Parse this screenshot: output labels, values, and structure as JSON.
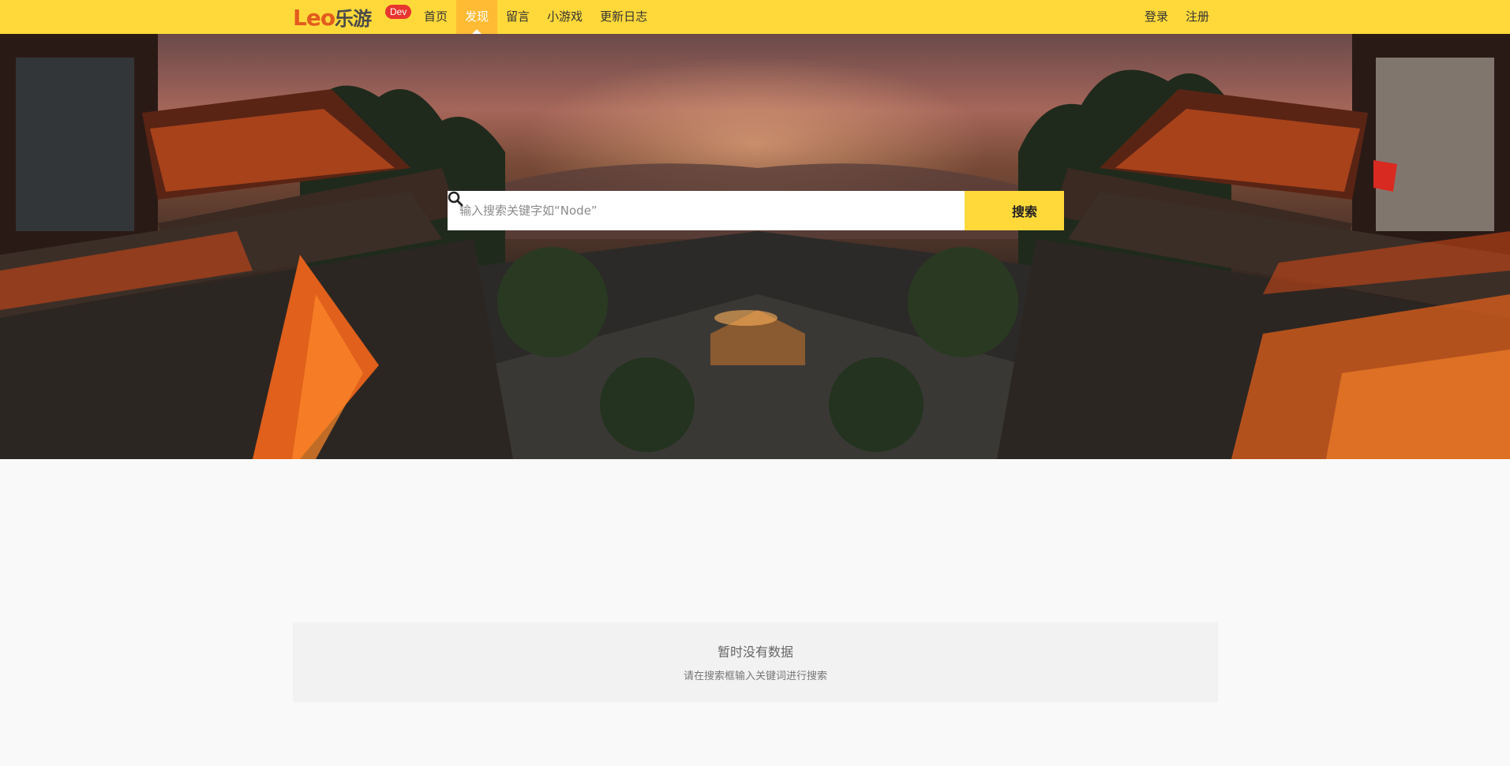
{
  "app": {
    "logo_text": "Leo",
    "logo_cn": "乐游",
    "badge": "Dev"
  },
  "nav": {
    "items": [
      {
        "label": "首页",
        "active": false
      },
      {
        "label": "发现",
        "active": true
      },
      {
        "label": "留言",
        "active": false
      },
      {
        "label": "小游戏",
        "active": false
      },
      {
        "label": "更新日志",
        "active": false
      }
    ],
    "login": "登录",
    "register": "注册"
  },
  "search": {
    "placeholder": "输入搜索关键字如“Node”",
    "value": "",
    "button_label": "搜索",
    "button_icon": "search-icon"
  },
  "empty_state": {
    "title": "暂时没有数据",
    "subtitle": "请在搜索框输入关键词进行搜索"
  },
  "colors": {
    "nav_bg": "#ffd93a",
    "nav_active": "#ffbb33",
    "badge": "#e8352f",
    "logo": "#e35b1e"
  }
}
